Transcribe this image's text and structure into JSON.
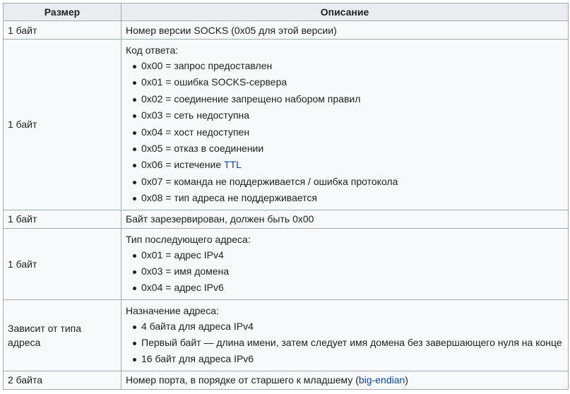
{
  "header": {
    "size": "Размер",
    "description": "Описание"
  },
  "rows": [
    {
      "size": "1 байт",
      "text": "Номер версии SOCKS (0x05 для этой версии)"
    },
    {
      "size": "1 байт",
      "intro": "Код ответа:",
      "items": [
        "0x00 = запрос предоставлен",
        "0x01 = ошибка SOCKS-сервера",
        "0x02 = соединение запрещено набором правил",
        "0x03 = сеть недоступна",
        "0x04 = хост недоступен",
        "0x05 = отказ в соединении",
        "0x07 = команда не поддерживается / ошибка протокола",
        "0x08 = тип адреса не поддерживается"
      ],
      "ttl_item": {
        "prefix": "0x06 = истечение ",
        "link": "TTL"
      }
    },
    {
      "size": "1 байт",
      "text": "Байт зарезервирован, должен быть 0x00"
    },
    {
      "size": "1 байт",
      "intro": "Тип последующего адреса:",
      "items": [
        "0x01 = адрес IPv4",
        "0x03 = имя домена",
        "0x04 = адрес IPv6"
      ]
    },
    {
      "size": "Зависит от типа адреса",
      "intro": "Назначение адреса:",
      "items": [
        "4 байта для адреса IPv4",
        "Первый байт — длина имени, затем следует имя домена без завершающего нуля на конце",
        "16 байт для адреса IPv6"
      ]
    },
    {
      "size": "2 байта",
      "text": "Номер порта, в порядке от старшего к младшему (",
      "link": "big-endian",
      "suffix": ")"
    }
  ],
  "colors": {
    "link": "#0645ad",
    "border": "#a2a9b1",
    "header_bg": "#eaecf0",
    "cell_bg": "#f8f9fa"
  }
}
